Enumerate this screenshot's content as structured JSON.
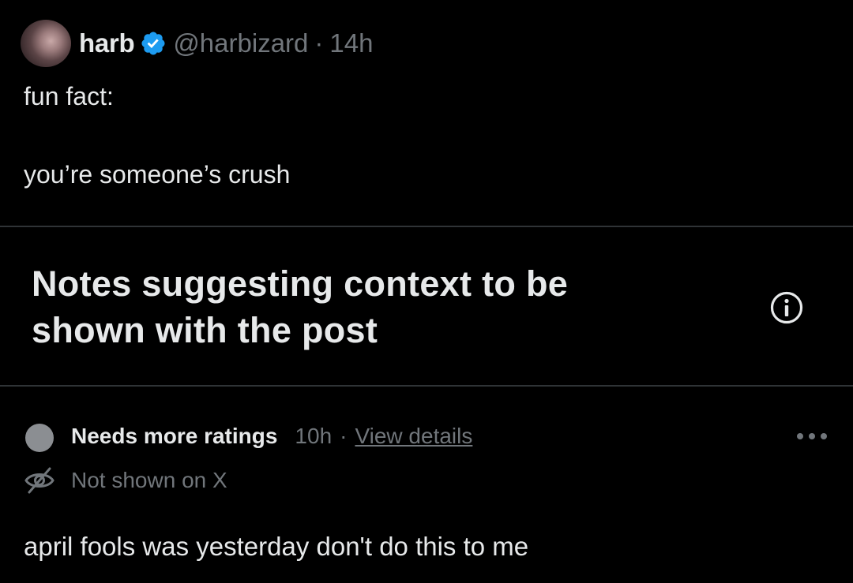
{
  "post": {
    "author": {
      "display_name": "harb",
      "handle": "@harbizard",
      "verified": true,
      "avatar_icon": "avatar-photo"
    },
    "separator": "·",
    "time": "14h",
    "text_lines": [
      "fun fact:",
      "you’re someone’s crush"
    ]
  },
  "notes_section": {
    "title": "Notes suggesting context to be shown with the post",
    "info_icon": "info-icon"
  },
  "note": {
    "status": "Needs more ratings",
    "time": "10h",
    "separator": "·",
    "details_link": "View details",
    "more_icon": "more-dots-icon",
    "visibility_icon": "eye-off-icon",
    "visibility_label": "Not shown on X",
    "text": "april fools was yesterday don't do this to me"
  },
  "colors": {
    "background": "#000000",
    "primary_text": "#e7e9ea",
    "secondary_text": "#71767b",
    "divider": "#2f3336",
    "verified_badge": "#1d9bf0",
    "status_dot": "#8b8e92"
  }
}
